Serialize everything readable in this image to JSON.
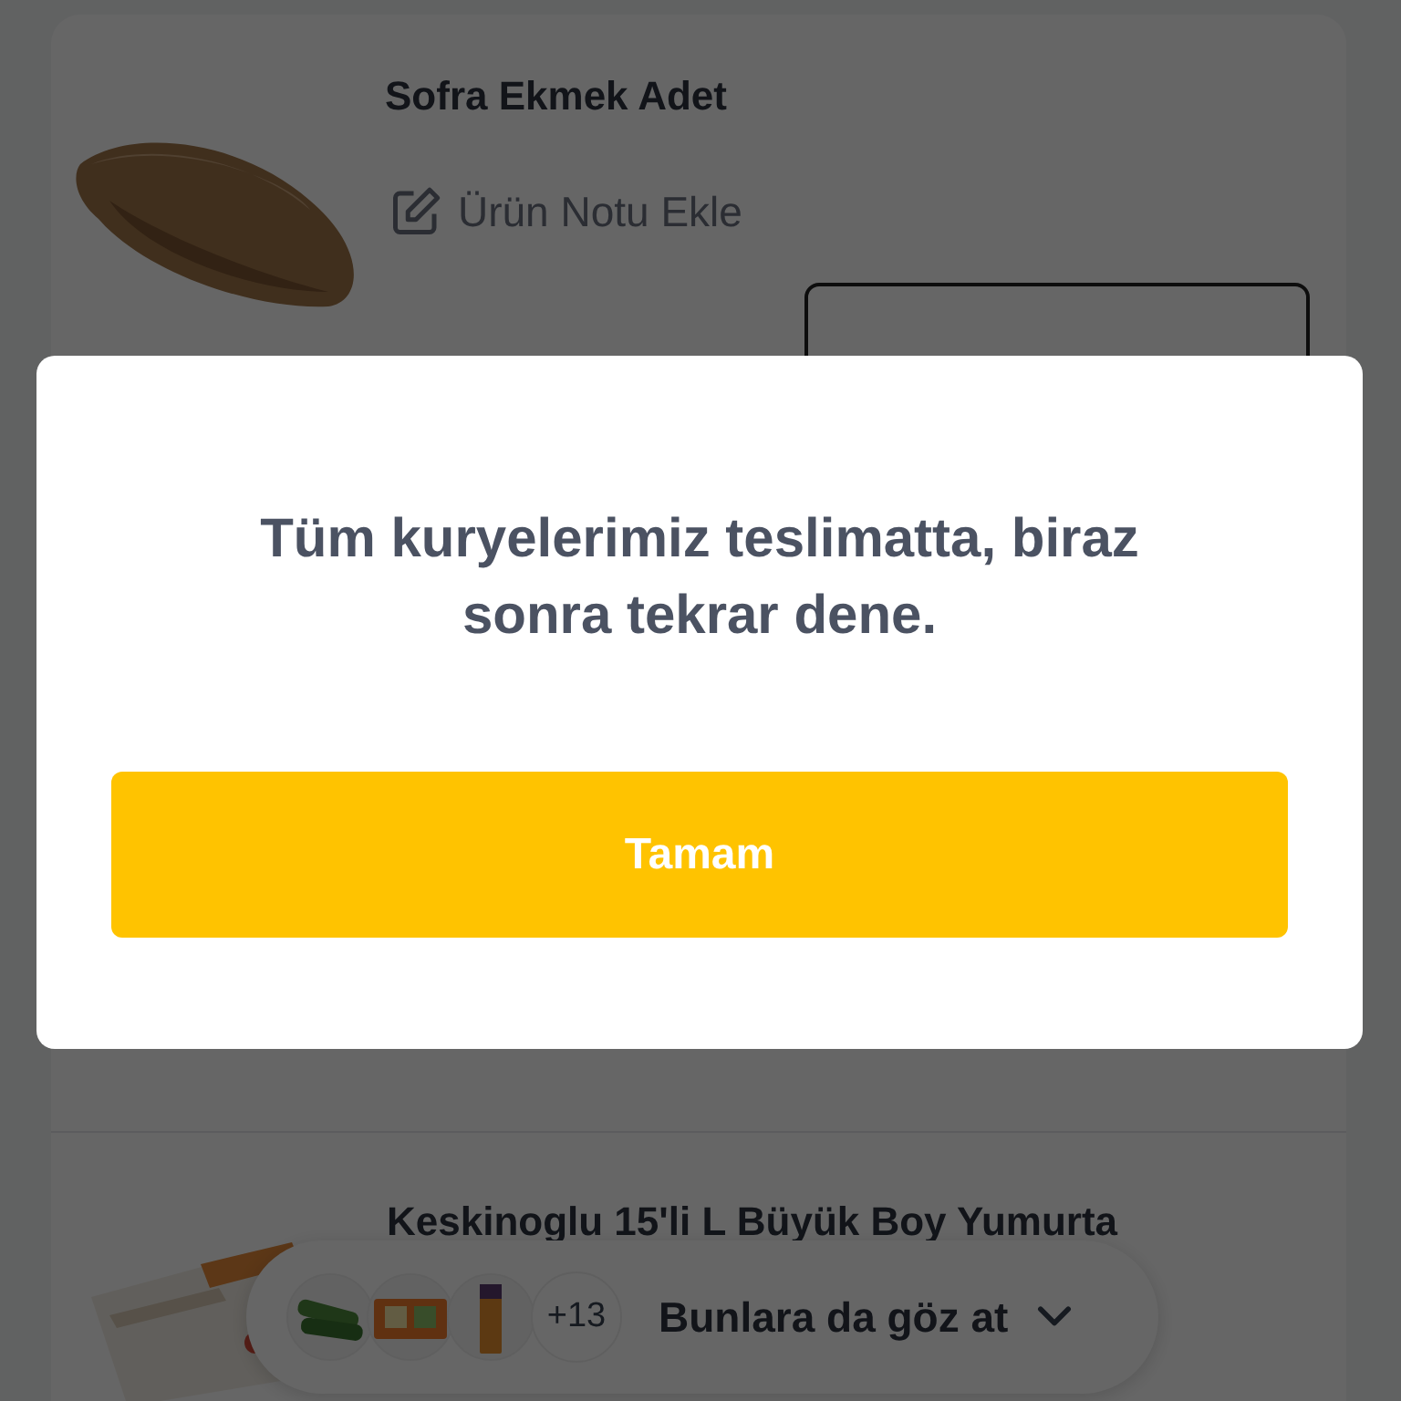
{
  "products": [
    {
      "name": "Sofra Ekmek Adet",
      "note_action": "Ürün Notu Ekle"
    },
    {
      "name": "Keskinoglu 15'li L Büyük Boy  Yumurta"
    }
  ],
  "suggestions": {
    "more_count": "+13",
    "label": "Bunlara da göz at"
  },
  "dialog": {
    "message": "Tüm kuryelerimiz teslimatta, biraz sonra tekrar dene.",
    "button": "Tamam"
  }
}
